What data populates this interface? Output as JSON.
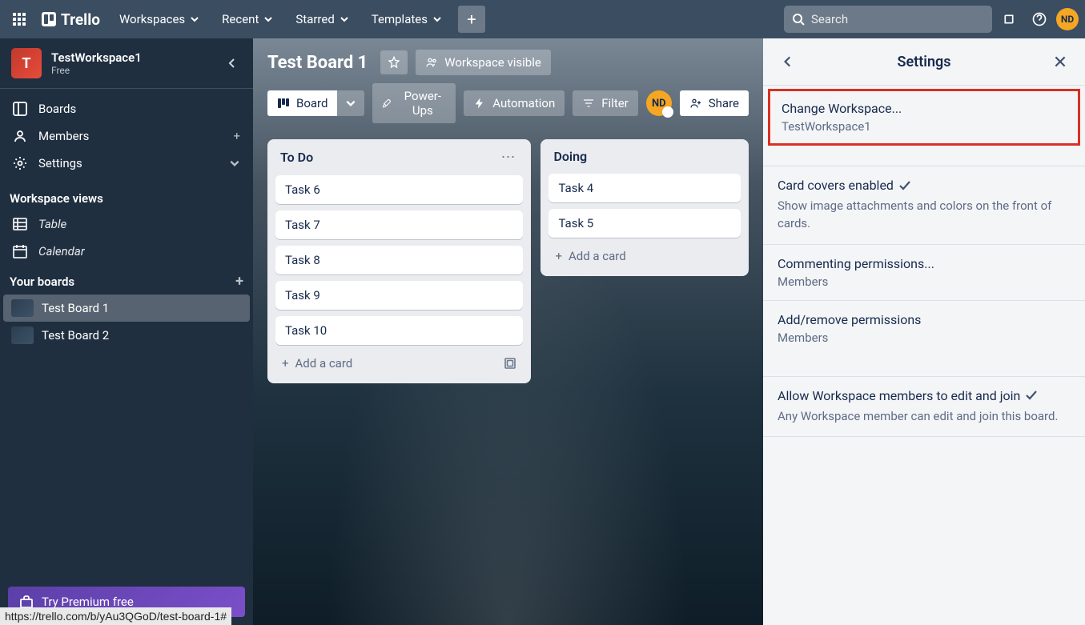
{
  "topbar": {
    "logo": "Trello",
    "nav": [
      "Workspaces",
      "Recent",
      "Starred",
      "Templates"
    ],
    "search_placeholder": "Search",
    "avatar": "ND"
  },
  "sidebar": {
    "workspace_initial": "T",
    "workspace_name": "TestWorkspace1",
    "workspace_plan": "Free",
    "nav": {
      "boards": "Boards",
      "members": "Members",
      "settings": "Settings"
    },
    "views_heading": "Workspace views",
    "views": [
      "Table",
      "Calendar"
    ],
    "boards_heading": "Your boards",
    "boards": [
      "Test Board 1",
      "Test Board 2"
    ],
    "premium": "Try Premium free"
  },
  "board": {
    "title": "Test Board 1",
    "visibility": "Workspace visible",
    "view_label": "Board",
    "toolbar": {
      "powerups": "Power-Ups",
      "automation": "Automation",
      "filter": "Filter",
      "share": "Share"
    },
    "member": "ND",
    "lists": [
      {
        "title": "To Do",
        "cards": [
          "Task 6",
          "Task 7",
          "Task 8",
          "Task 9",
          "Task 10"
        ],
        "add": "Add a card"
      },
      {
        "title": "Doing",
        "cards": [
          "Task 4",
          "Task 5"
        ],
        "add": "Add a card"
      }
    ]
  },
  "settings": {
    "title": "Settings",
    "change_ws": "Change Workspace...",
    "change_ws_value": "TestWorkspace1",
    "covers_label": "Card covers enabled",
    "covers_desc": "Show image attachments and colors on the front of cards.",
    "comment_label": "Commenting permissions...",
    "comment_value": "Members",
    "addremove_label": "Add/remove permissions",
    "addremove_value": "Members",
    "allow_label": "Allow Workspace members to edit and join",
    "allow_desc": "Any Workspace member can edit and join this board."
  },
  "status_url": "https://trello.com/b/yAu3QGoD/test-board-1#"
}
